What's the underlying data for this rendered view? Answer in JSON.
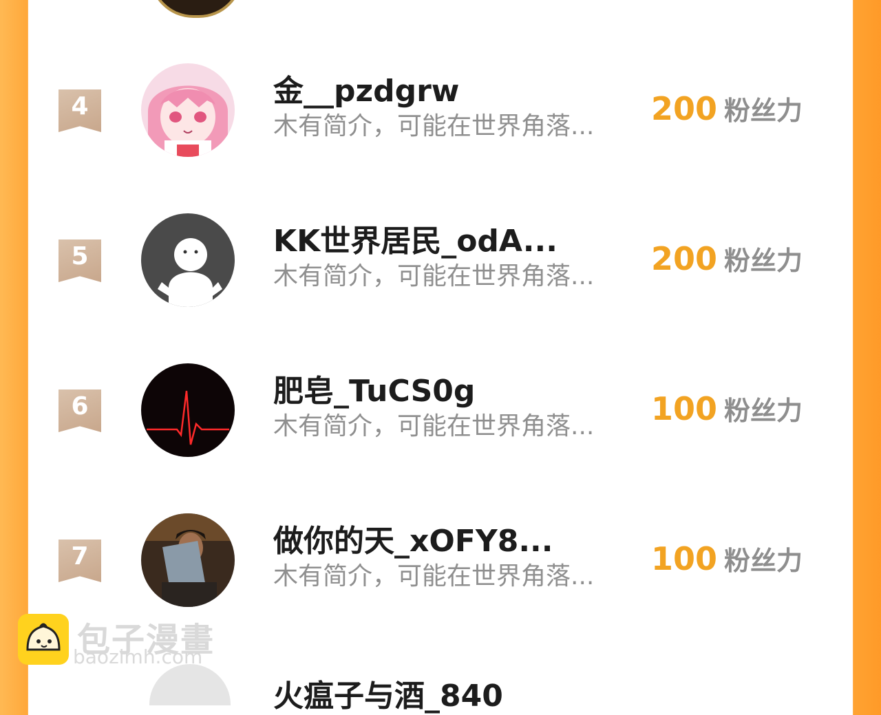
{
  "colors": {
    "accent": "#f2a322",
    "rank_badge": "#c8a78c",
    "name": "#1c1c1c",
    "muted": "#8f8f8f"
  },
  "rows": [
    {
      "rank": "4",
      "name": "金__pzdgrw",
      "bio": "木有简介，可能在世界角落...",
      "score": "200",
      "unit": "粉丝力",
      "avatar": "anime-girl-avatar"
    },
    {
      "rank": "5",
      "name": "KK世界居民_odA...",
      "bio": "木有简介，可能在世界角落...",
      "score": "200",
      "unit": "粉丝力",
      "avatar": "default-ghost-avatar"
    },
    {
      "rank": "6",
      "name": "肥皂_TuCS0g",
      "bio": "木有简介，可能在世界角落...",
      "score": "100",
      "unit": "粉丝力",
      "avatar": "heartbeat-avatar"
    },
    {
      "rank": "7",
      "name": "做你的天_xOFY8...",
      "bio": "木有简介，可能在世界角落...",
      "score": "100",
      "unit": "粉丝力",
      "avatar": "photo-person-avatar"
    }
  ],
  "partial_next": {
    "name": "火瘟子与酒_840"
  },
  "watermark": {
    "cn": "包子漫畫",
    "en": "baozimh.com"
  }
}
